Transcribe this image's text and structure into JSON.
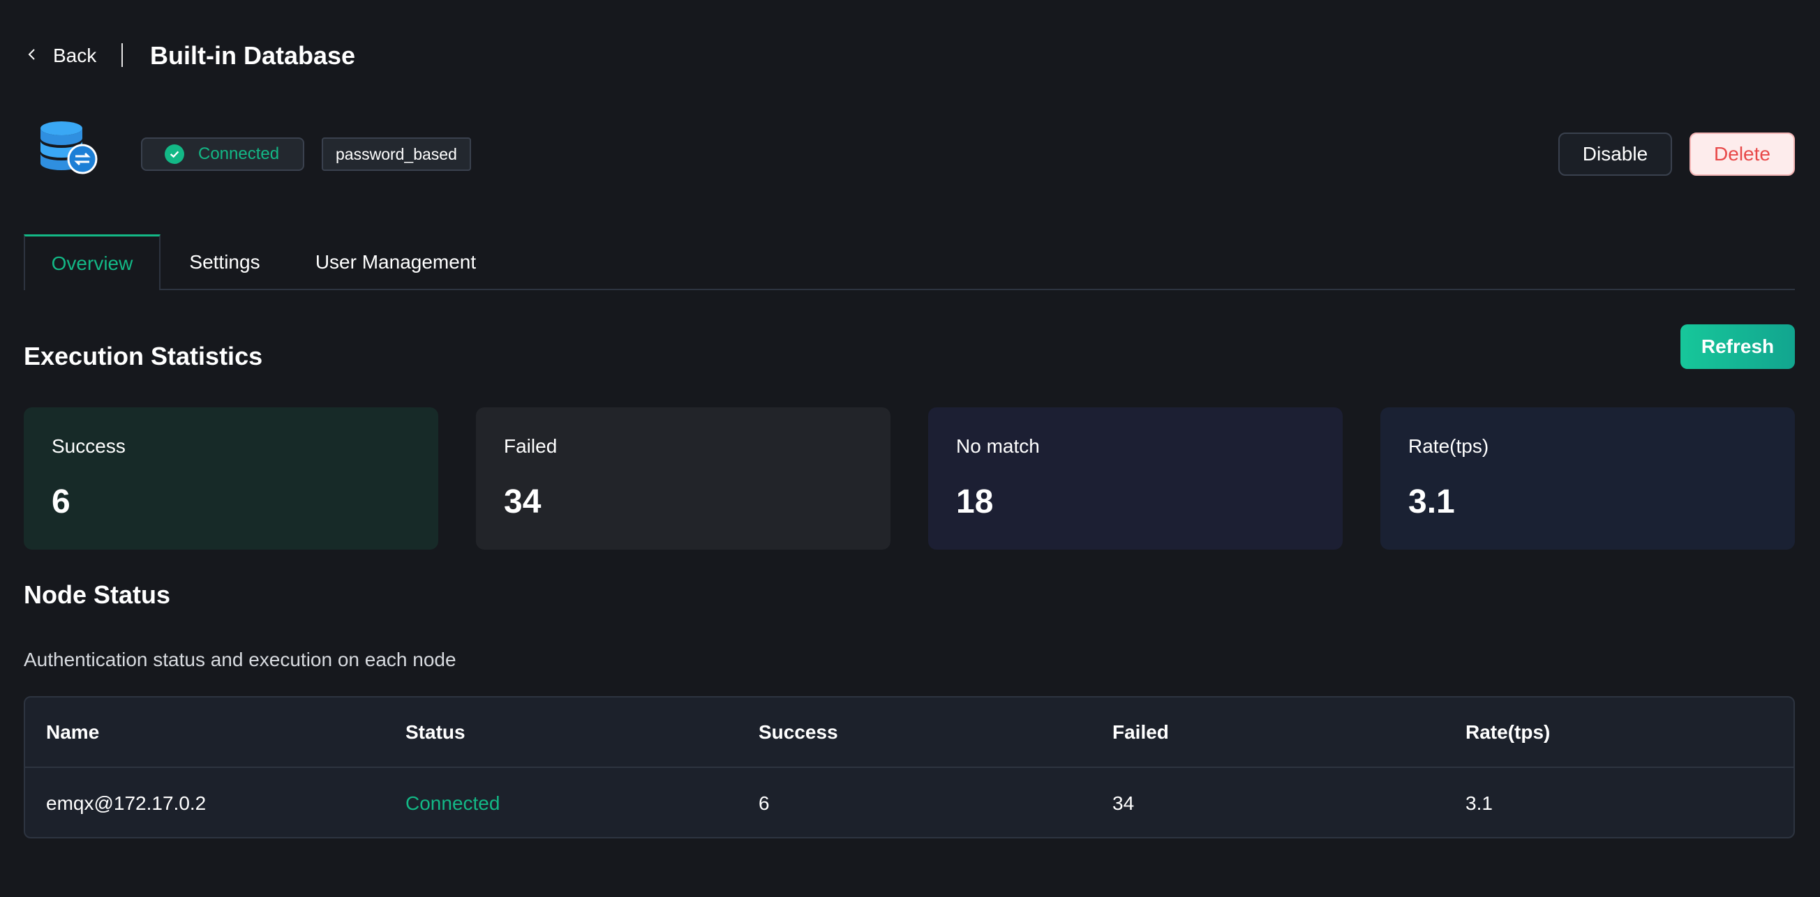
{
  "header": {
    "back_label": "Back",
    "title": "Built-in Database"
  },
  "info": {
    "icon": "database-icon",
    "status": "Connected",
    "mechanism": "password_based",
    "disable_label": "Disable",
    "delete_label": "Delete"
  },
  "tabs": [
    {
      "label": "Overview",
      "active": true
    },
    {
      "label": "Settings",
      "active": false
    },
    {
      "label": "User Management",
      "active": false
    }
  ],
  "execution": {
    "title": "Execution Statistics",
    "refresh_label": "Refresh",
    "cards": [
      {
        "label": "Success",
        "value": "6",
        "bg": "#172a28"
      },
      {
        "label": "Failed",
        "value": "34",
        "bg": "#222429"
      },
      {
        "label": "No match",
        "value": "18",
        "bg": "#1c1f33"
      },
      {
        "label": "Rate(tps)",
        "value": "3.1",
        "bg": "#1a2133"
      }
    ]
  },
  "nodes": {
    "title": "Node Status",
    "description": "Authentication status and execution on each node",
    "columns": [
      "Name",
      "Status",
      "Success",
      "Failed",
      "Rate(tps)"
    ],
    "rows": [
      {
        "name": "emqx@172.17.0.2",
        "status": "Connected",
        "success": "6",
        "failed": "34",
        "rate": "3.1"
      }
    ]
  },
  "colors": {
    "accent": "#13b886",
    "danger": "#e84848",
    "background": "#16181d"
  }
}
